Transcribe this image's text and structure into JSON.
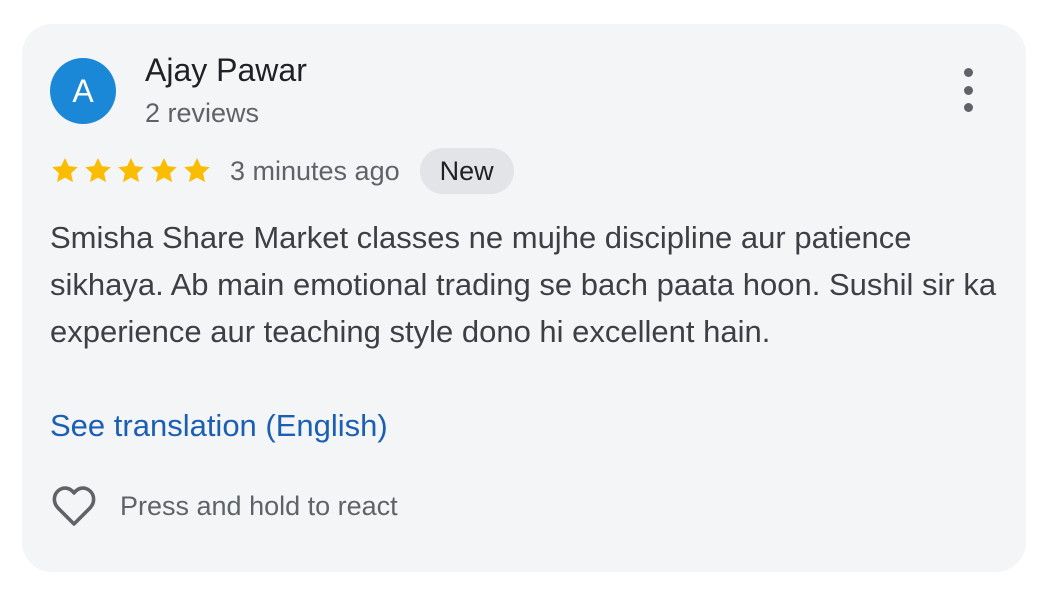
{
  "colors": {
    "card_background": "#f4f5f7",
    "avatar_background": "#1a88d6",
    "star": "#fbbc04",
    "link": "#1a5fb4",
    "badge_background": "#e3e4e7"
  },
  "review": {
    "author": {
      "avatar_initial": "A",
      "name": "Ajay Pawar",
      "reviews_count": "2 reviews"
    },
    "more_menu_icon": "more-vert-icon",
    "rating": 5,
    "rating_max": 5,
    "time_ago": "3 minutes ago",
    "badge": "New",
    "text": "Smisha Share Market classes ne mujhe discipline aur patience sikhaya. Ab main emotional trading se bach paata hoon. Sushil sir ka experience aur teaching style dono hi excellent hain.",
    "translation_link": "See translation (English)",
    "react": {
      "icon": "heart-outline-icon",
      "label": "Press and hold to react"
    }
  }
}
